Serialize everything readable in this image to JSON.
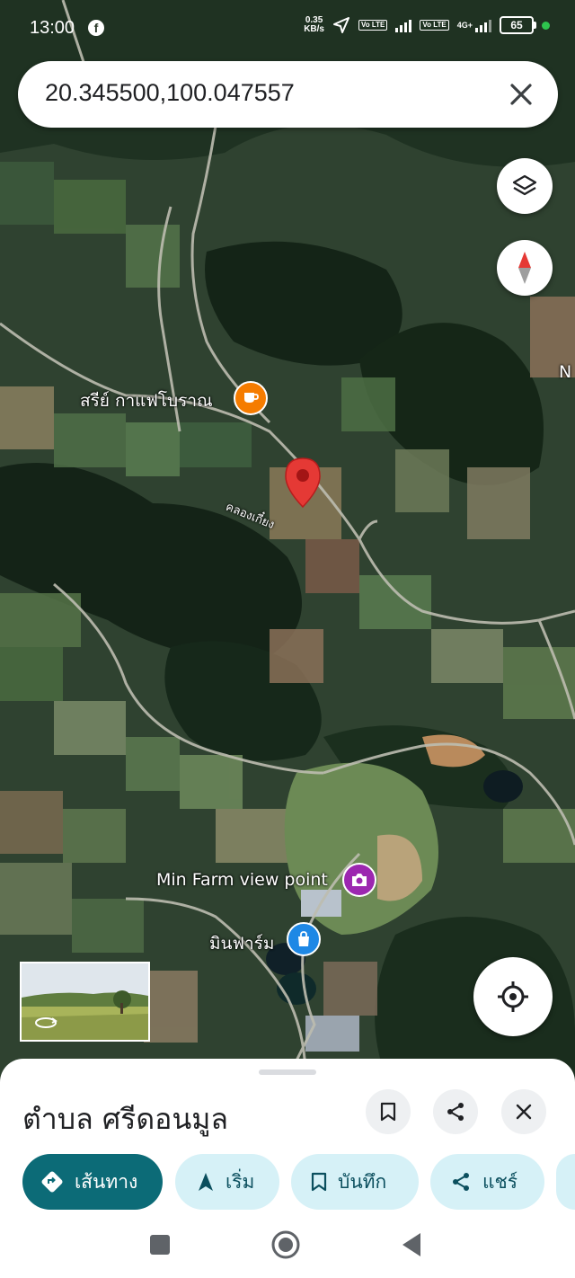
{
  "status_bar": {
    "time": "13:00",
    "app_icon": "facebook-icon",
    "speed_value": "0.35",
    "speed_unit": "KB/s",
    "network_tag": "4G+",
    "volte_1": "Vo LTE",
    "volte_2": "Vo LTE",
    "battery": "65"
  },
  "search": {
    "query": "20.345500,100.047557"
  },
  "map_labels": {
    "cafe": "สรีย์ กาแฟโบราณ",
    "canal": "คลองเกี๋ยง",
    "viewpoint": "Min Farm view point",
    "farm": "มินฟาร์ม",
    "edge_letter": "N"
  },
  "place_sheet": {
    "title": "ตำบล ศรีดอนมูล",
    "actions": [
      {
        "label": "เส้นทาง",
        "icon": "directions-icon"
      },
      {
        "label": "เริ่ม",
        "icon": "navigation-arrow-icon"
      },
      {
        "label": "บันทึก",
        "icon": "bookmark-icon"
      },
      {
        "label": "แชร์",
        "icon": "share-icon"
      }
    ]
  },
  "colors": {
    "primary_chip": "#0c6b77",
    "chip": "#d6f1f7",
    "pin": "#e53935",
    "cafe_marker": "#f57c00",
    "viewpoint_marker": "#9c27b0",
    "shop_marker": "#1e88e5"
  }
}
